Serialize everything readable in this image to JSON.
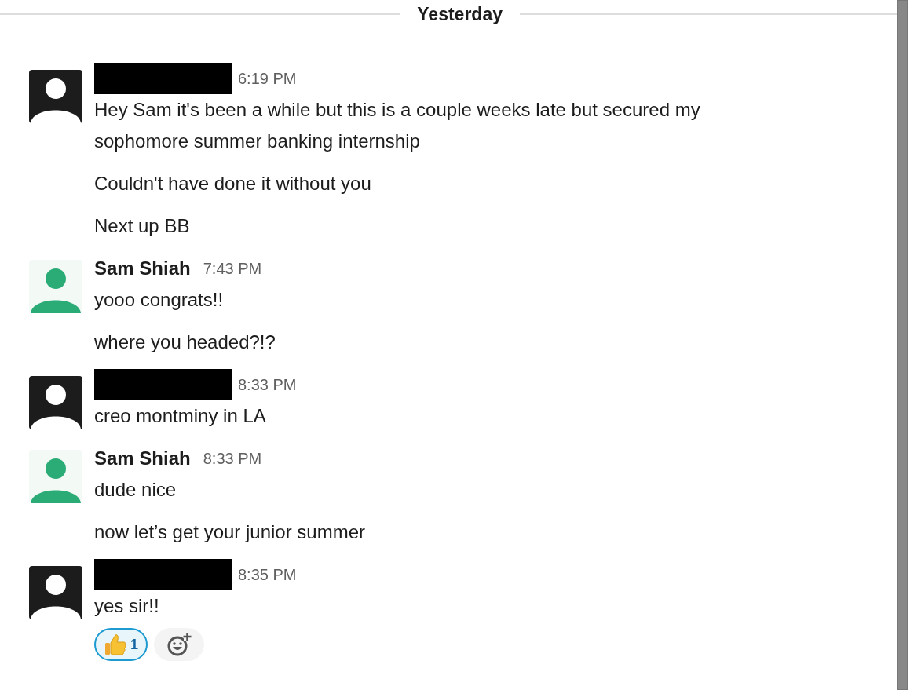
{
  "date_divider": "Yesterday",
  "messages": [
    {
      "color": "#1d1c1d",
      "redacted": true,
      "time": "6:19 PM",
      "paragraphs": [
        "Hey Sam it's been a while but this is a couple weeks late but secured my sophomore summer banking internship",
        "Couldn't have done it without you",
        "Next up BB"
      ]
    },
    {
      "color": "#2bac76",
      "redacted": false,
      "author": "Sam Shiah",
      "time": "7:43 PM",
      "paragraphs": [
        "yooo congrats!!",
        "where you headed?!?"
      ]
    },
    {
      "color": "#1d1c1d",
      "redacted": true,
      "time": "8:33 PM",
      "paragraphs": [
        "creo montminy in LA"
      ]
    },
    {
      "color": "#2bac76",
      "redacted": false,
      "author": "Sam Shiah",
      "time": "8:33 PM",
      "paragraphs": [
        "dude nice",
        "now let’s get your junior summer"
      ]
    },
    {
      "color": "#1d1c1d",
      "redacted": true,
      "time": "8:35 PM",
      "paragraphs": [
        "yes sir!!"
      ],
      "reactions": [
        {
          "count": "1",
          "selected": true
        }
      ]
    }
  ]
}
